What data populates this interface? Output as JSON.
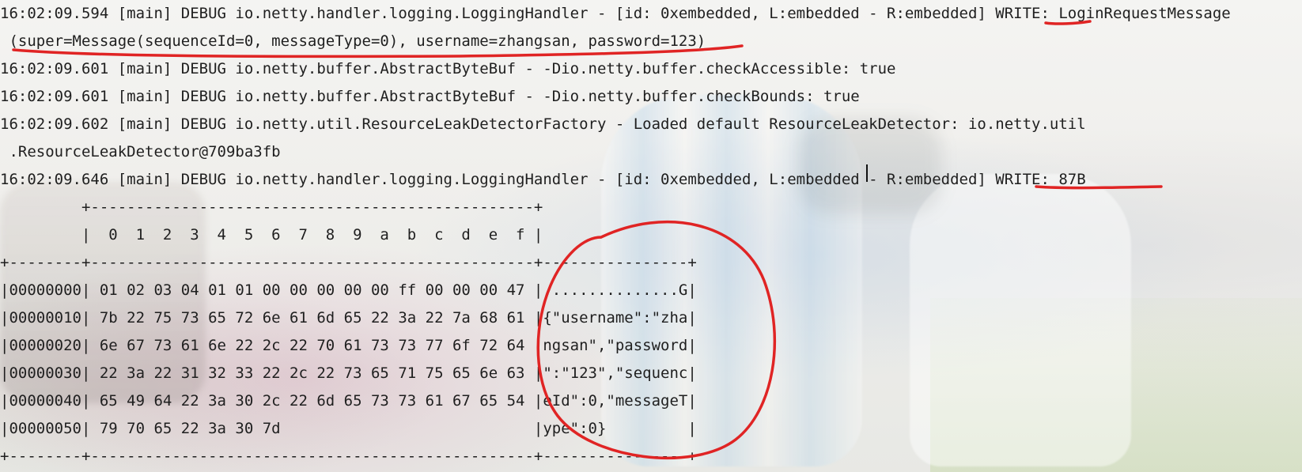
{
  "console": {
    "lines": [
      "16:02:09.594 [main] DEBUG io.netty.handler.logging.LoggingHandler - [id: 0xembedded, L:embedded - R:embedded] WRITE: LoginRequestMessage",
      " (super=Message(sequenceId=0, messageType=0), username=zhangsan, password=123)",
      "16:02:09.601 [main] DEBUG io.netty.buffer.AbstractByteBuf - -Dio.netty.buffer.checkAccessible: true",
      "16:02:09.601 [main] DEBUG io.netty.buffer.AbstractByteBuf - -Dio.netty.buffer.checkBounds: true",
      "16:02:09.602 [main] DEBUG io.netty.util.ResourceLeakDetectorFactory - Loaded default ResourceLeakDetector: io.netty.util",
      " .ResourceLeakDetector@709ba3fb",
      "16:02:09.646 [main] DEBUG io.netty.handler.logging.LoggingHandler - [id: 0xembedded, L:embedded - R:embedded] WRITE: 87B",
      "         +-------------------------------------------------+",
      "         |  0  1  2  3  4  5  6  7  8  9  a  b  c  d  e  f |",
      "+--------+-------------------------------------------------+----------------+",
      "|00000000| 01 02 03 04 01 01 00 00 00 00 00 ff 00 00 00 47 |...............G|",
      "|00000010| 7b 22 75 73 65 72 6e 61 6d 65 22 3a 22 7a 68 61 |{\"username\":\"zha|",
      "|00000020| 6e 67 73 61 6e 22 2c 22 70 61 73 73 77 6f 72 64 |ngsan\",\"password|",
      "|00000030| 22 3a 22 31 32 33 22 2c 22 73 65 71 75 65 6e 63 |\":\"123\",\"sequenc|",
      "|00000040| 65 49 64 22 3a 30 2c 22 6d 65 73 73 61 67 65 54 |eId\":0,\"messageT|",
      "|00000050| 79 70 65 22 3a 30 7d                            |ype\":0}         |",
      "+--------+-------------------------------------------------+----------------+"
    ]
  },
  "annotation_color": "#e02424"
}
